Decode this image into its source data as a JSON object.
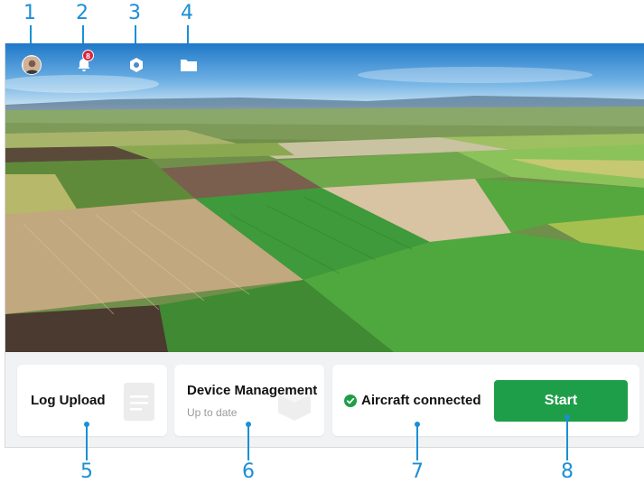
{
  "callouts": [
    "1",
    "2",
    "3",
    "4",
    "5",
    "6",
    "7",
    "8"
  ],
  "topbar": {
    "notification_count": "8",
    "icons": [
      "avatar-icon",
      "bell-icon",
      "settings-hexagon-icon",
      "folder-icon"
    ]
  },
  "cards": {
    "log_upload": {
      "title": "Log Upload",
      "icon": "document-icon"
    },
    "device_management": {
      "title": "Device Management",
      "status": "Up to date",
      "icon": "box-icon"
    },
    "aircraft": {
      "status": "Aircraft connected",
      "icon": "check-circle-icon",
      "start_label": "Start"
    }
  },
  "colors": {
    "callout": "#1a8fd6",
    "start_button": "#1e9e48",
    "badge": "#d7263d",
    "status_check": "#1e9e48"
  }
}
